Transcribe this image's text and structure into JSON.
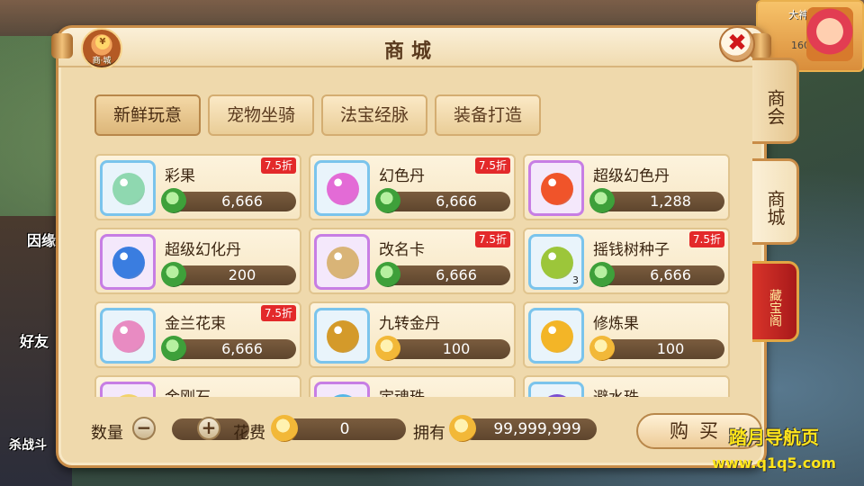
{
  "background": {
    "left_labels": [
      "因缘",
      "好友",
      "杀战斗"
    ],
    "player": {
      "name": "大神",
      "level": "160"
    }
  },
  "dialog": {
    "title": "商城",
    "badge_label": "商·城",
    "badge_coin": "¥",
    "close_glyph": "✖"
  },
  "category_tabs": [
    {
      "label": "新鲜玩意",
      "active": true
    },
    {
      "label": "宠物坐骑",
      "active": false
    },
    {
      "label": "法宝经脉",
      "active": false
    },
    {
      "label": "装备打造",
      "active": false
    }
  ],
  "items": [
    {
      "name": "彩果",
      "price": "6,666",
      "currency": "jade",
      "discount": "7.5折",
      "frame": "blue",
      "gem_color": "#8fd8b0",
      "qty": ""
    },
    {
      "name": "幻色丹",
      "price": "6,666",
      "currency": "jade",
      "discount": "7.5折",
      "frame": "blue",
      "gem_color": "#e36bd6",
      "qty": ""
    },
    {
      "name": "超级幻色丹",
      "price": "1,288",
      "currency": "jade",
      "discount": "",
      "frame": "purple",
      "gem_color": "#f0542a",
      "qty": ""
    },
    {
      "name": "超级幻化丹",
      "price": "200",
      "currency": "jade",
      "discount": "",
      "frame": "purple",
      "gem_color": "#3a7de0",
      "qty": ""
    },
    {
      "name": "改名卡",
      "price": "6,666",
      "currency": "jade",
      "discount": "7.5折",
      "frame": "purple",
      "gem_color": "#d9b477",
      "qty": ""
    },
    {
      "name": "摇钱树种子",
      "price": "6,666",
      "currency": "jade",
      "discount": "7.5折",
      "frame": "blue",
      "gem_color": "#9cc63a",
      "qty": "3"
    },
    {
      "name": "金兰花束",
      "price": "6,666",
      "currency": "jade",
      "discount": "7.5折",
      "frame": "blue",
      "gem_color": "#e88bc2",
      "qty": ""
    },
    {
      "name": "九转金丹",
      "price": "100",
      "currency": "gold",
      "discount": "",
      "frame": "blue",
      "gem_color": "#d49a2a",
      "qty": ""
    },
    {
      "name": "修炼果",
      "price": "100",
      "currency": "gold",
      "discount": "",
      "frame": "blue",
      "gem_color": "#f3b527",
      "qty": ""
    },
    {
      "name": "金刚石",
      "price": "",
      "currency": "jade",
      "discount": "",
      "frame": "purple",
      "gem_color": "#f2d36b",
      "qty": ""
    },
    {
      "name": "定魂珠",
      "price": "",
      "currency": "jade",
      "discount": "",
      "frame": "purple",
      "gem_color": "#56b7e6",
      "qty": ""
    },
    {
      "name": "避水珠",
      "price": "",
      "currency": "jade",
      "discount": "",
      "frame": "blue",
      "gem_color": "#7b4fd0",
      "qty": ""
    }
  ],
  "bottom": {
    "qty_label": "数量",
    "minus": "−",
    "qty_value": "0",
    "plus": "+",
    "cost_label": "花费",
    "cost_value": "0",
    "own_label": "拥有",
    "own_value": "99,999,999",
    "buy_label": "购买"
  },
  "side_tabs": [
    {
      "label": "商会",
      "active": false,
      "style": "normal"
    },
    {
      "label": "商城",
      "active": true,
      "style": "normal"
    },
    {
      "label": "藏宝阁",
      "active": false,
      "style": "treasure"
    }
  ],
  "watermark": {
    "title": "踏月导航页",
    "url": "www.q1q5.com"
  }
}
